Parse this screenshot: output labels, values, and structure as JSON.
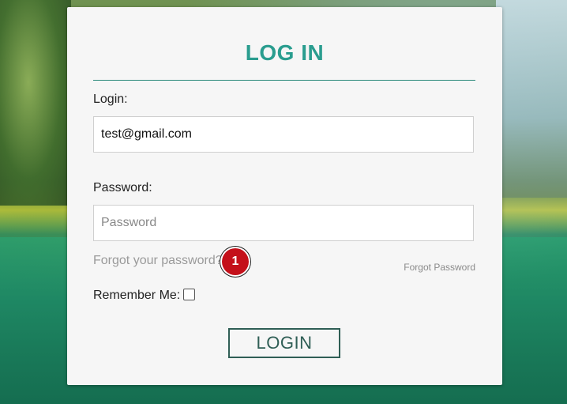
{
  "form": {
    "title": "LOG IN",
    "login_label": "Login:",
    "login_value": "test@gmail.com",
    "password_label": "Password:",
    "password_placeholder": "Password",
    "forgot_link": "Forgot your password?",
    "badge_number": "1",
    "forgot_small": "Forgot Password",
    "remember_label": "Remember Me:",
    "login_button": "LOGIN"
  },
  "colors": {
    "accent": "#2a9d8f",
    "badge": "#c4101a",
    "button_border": "#2f5e55"
  }
}
